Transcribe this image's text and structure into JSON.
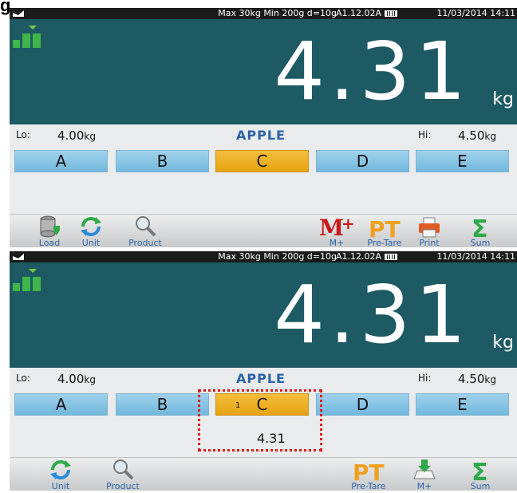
{
  "figure_label": "g",
  "panels": [
    {
      "status": {
        "specs": "Max 30kg  Min 200g  d=10g",
        "firmware": "A1.12.02A",
        "datetime": "11/03/2014  14:11"
      },
      "weight": {
        "value": "4.31",
        "unit": "kg"
      },
      "limits": {
        "lo_label": "Lo:",
        "lo_value": "4.00",
        "lo_unit": "kg",
        "hi_label": "Hi:",
        "hi_value": "4.50",
        "hi_unit": "kg"
      },
      "product_name": "APPLE",
      "keys": [
        "A",
        "B",
        "C",
        "D",
        "E"
      ],
      "selected_key": "C",
      "toolbar": {
        "load": "Load",
        "unit": "Unit",
        "product": "Product",
        "mplus": "M+",
        "pretare": "Pre-Tare",
        "print": "Print",
        "sum": "Sum"
      }
    },
    {
      "status": {
        "specs": "Max 30kg  Min 200g  d=10g",
        "firmware": "A1.12.02A",
        "datetime": "11/03/2014  14:11"
      },
      "weight": {
        "value": "4.31",
        "unit": "kg"
      },
      "limits": {
        "lo_label": "Lo:",
        "lo_value": "4.00",
        "lo_unit": "kg",
        "hi_label": "Hi:",
        "hi_value": "4.50",
        "hi_unit": "kg"
      },
      "product_name": "APPLE",
      "keys": [
        "A",
        "B",
        "C",
        "D",
        "E"
      ],
      "selected_key": "C",
      "selected_count": "1",
      "accumulated_value": "4.31",
      "toolbar": {
        "unit": "Unit",
        "product": "Product",
        "pretare": "Pre-Tare",
        "mplus": "M+",
        "sum": "Sum"
      }
    }
  ],
  "colors": {
    "display_bg": "#1d5a63",
    "key_blue": "#8cc7e6",
    "key_selected": "#eeb22a",
    "accent_text": "#2a62a8",
    "highlight": "#dd1a1a"
  },
  "icons": [
    "signal-icon",
    "battery-icon",
    "stability-icon",
    "database-load-icon",
    "unit-cycle-icon",
    "product-search-icon",
    "memory-plus-icon",
    "pre-tare-icon",
    "printer-icon",
    "sum-icon",
    "memory-download-icon"
  ]
}
